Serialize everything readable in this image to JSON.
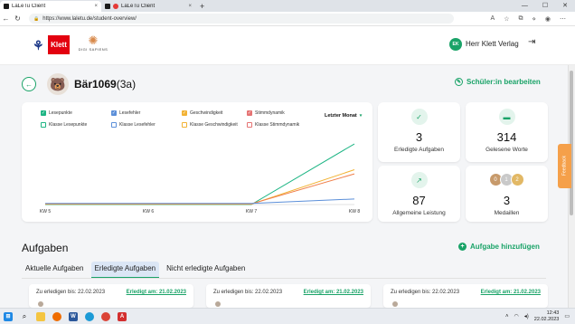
{
  "browser": {
    "tabs": [
      {
        "title": "LaLeTu Client",
        "active": true
      },
      {
        "title": "LaLeTu Client",
        "active": false
      }
    ],
    "url": "https://www.laletu.de/student-overview/",
    "new_tab": "+",
    "tab_close": "×"
  },
  "header": {
    "logo_klett": "Klett",
    "logo_digi": "DIGI SAPIENS",
    "user_initials": "EK",
    "user_name": "Herr Klett Verlag"
  },
  "student": {
    "name": "Bär1069",
    "class": "(3a)",
    "edit_label": "Schüler:in bearbeiten"
  },
  "chart_data": {
    "type": "line",
    "x": [
      "KW 5",
      "KW 6",
      "KW 7",
      "KW 8"
    ],
    "period_label": "Letzter Monat",
    "legend": [
      {
        "label": "Lesepunkte",
        "checked": true,
        "color": "#1db584"
      },
      {
        "label": "Lesefehler",
        "checked": true,
        "color": "#5b8fd9"
      },
      {
        "label": "Geschwindigkeit",
        "checked": true,
        "color": "#f2b233"
      },
      {
        "label": "Stimmdynamik",
        "checked": true,
        "color": "#e57373"
      },
      {
        "label": "Klasse Lesepunkte",
        "checked": false,
        "color": "#1db584"
      },
      {
        "label": "Klasse Lesefehler",
        "checked": false,
        "color": "#5b8fd9"
      },
      {
        "label": "Klasse Geschwindigkeit",
        "checked": false,
        "color": "#f2b233"
      },
      {
        "label": "Klasse Stimmdynamik",
        "checked": false,
        "color": "#e57373"
      }
    ],
    "series": [
      {
        "name": "Lesepunkte",
        "color": "#1db584",
        "values": [
          0,
          0,
          0,
          87
        ]
      },
      {
        "name": "Geschwindigkeit",
        "color": "#f2b233",
        "values": [
          0,
          0,
          0,
          50
        ]
      },
      {
        "name": "Stimmdynamik",
        "color": "#f07f4a",
        "values": [
          0,
          0,
          0,
          44
        ]
      },
      {
        "name": "Lesefehler",
        "color": "#5b8fd9",
        "values": [
          0,
          0,
          0,
          8
        ]
      }
    ],
    "ylim": [
      0,
      100
    ],
    "grid": false
  },
  "stats": [
    {
      "value": "3",
      "label": "Erledigte Aufgaben",
      "icon": "check-icon"
    },
    {
      "value": "314",
      "label": "Gelesene Worte",
      "icon": "message-icon"
    },
    {
      "value": "87",
      "label": "Allgemeine Leistung",
      "icon": "trend-up-icon"
    },
    {
      "value": "3",
      "label": "Medaillen",
      "icon": "medals-icon"
    }
  ],
  "medals": [
    "0",
    "1",
    "2"
  ],
  "feedback_label": "Feedback",
  "tasks": {
    "title": "Aufgaben",
    "add_label": "Aufgabe hinzufügen",
    "tabs": [
      "Aktuelle Aufgaben",
      "Erledigte Aufgaben",
      "Nicht erledigte Aufgaben"
    ],
    "active_tab": 1,
    "cards": [
      {
        "due": "Zu erledigen bis: 22.02.2023",
        "done": "Erledigt am: 21.02.2023"
      },
      {
        "due": "Zu erledigen bis: 22.02.2023",
        "done": "Erledigt am: 21.02.2023"
      },
      {
        "due": "Zu erledigen bis: 22.02.2023",
        "done": "Erledigt am: 21.02.2023"
      }
    ]
  },
  "taskbar": {
    "time": "12:43",
    "date": "22.02.2023"
  },
  "colors": {
    "accent": "#1aa368",
    "klett_red": "#e3000f",
    "feedback": "#f5a04a"
  }
}
